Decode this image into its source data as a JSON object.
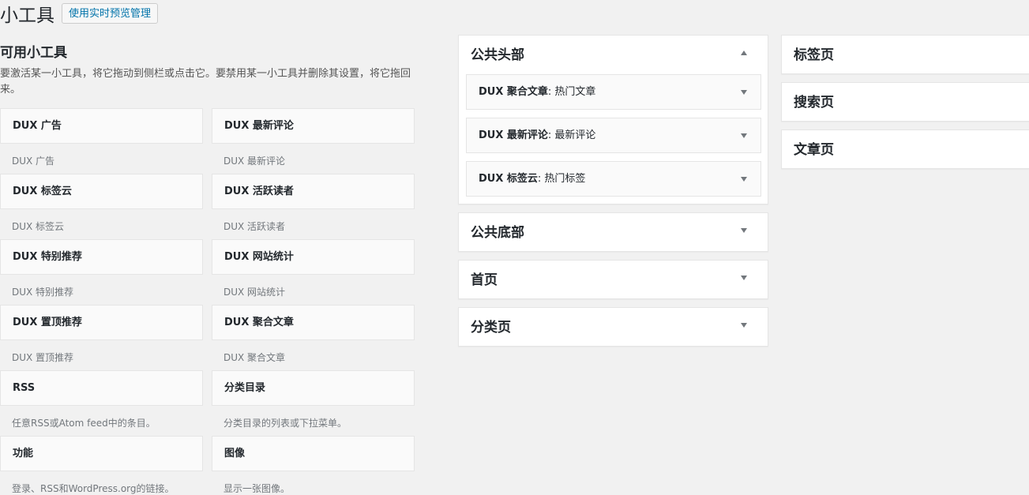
{
  "header": {
    "title": "小工具",
    "manage_label": "使用实时预览管理"
  },
  "available": {
    "heading": "可用小工具",
    "description": "要激活某一小工具，将它拖动到侧栏或点击它。要禁用某一小工具并删除其设置，将它拖回来。",
    "widgets": [
      {
        "title": "DUX 广告",
        "desc": "DUX 广告"
      },
      {
        "title": "DUX 最新评论",
        "desc": "DUX 最新评论"
      },
      {
        "title": "DUX 标签云",
        "desc": "DUX 标签云"
      },
      {
        "title": "DUX 活跃读者",
        "desc": "DUX 活跃读者"
      },
      {
        "title": "DUX 特别推荐",
        "desc": "DUX 特别推荐"
      },
      {
        "title": "DUX 网站统计",
        "desc": "DUX 网站统计"
      },
      {
        "title": "DUX 置顶推荐",
        "desc": "DUX 置顶推荐"
      },
      {
        "title": "DUX 聚合文章",
        "desc": "DUX 聚合文章"
      },
      {
        "title": "RSS",
        "desc": "任意RSS或Atom feed中的条目。"
      },
      {
        "title": "分类目录",
        "desc": "分类目录的列表或下拉菜单。"
      },
      {
        "title": "功能",
        "desc": "登录、RSS和WordPress.org的链接。"
      },
      {
        "title": "图像",
        "desc": "显示一张图像。"
      }
    ]
  },
  "sidebars_col1": [
    {
      "title": "公共头部",
      "expanded": true,
      "widgets": [
        {
          "name": "DUX 聚合文章",
          "suffix": ": 热门文章"
        },
        {
          "name": "DUX 最新评论",
          "suffix": ": 最新评论"
        },
        {
          "name": "DUX 标签云",
          "suffix": ": 热门标签"
        }
      ]
    },
    {
      "title": "公共底部",
      "expanded": false
    },
    {
      "title": "首页",
      "expanded": false
    },
    {
      "title": "分类页",
      "expanded": false
    }
  ],
  "sidebars_col2": [
    {
      "title": "标签页"
    },
    {
      "title": "搜索页"
    },
    {
      "title": "文章页"
    }
  ]
}
